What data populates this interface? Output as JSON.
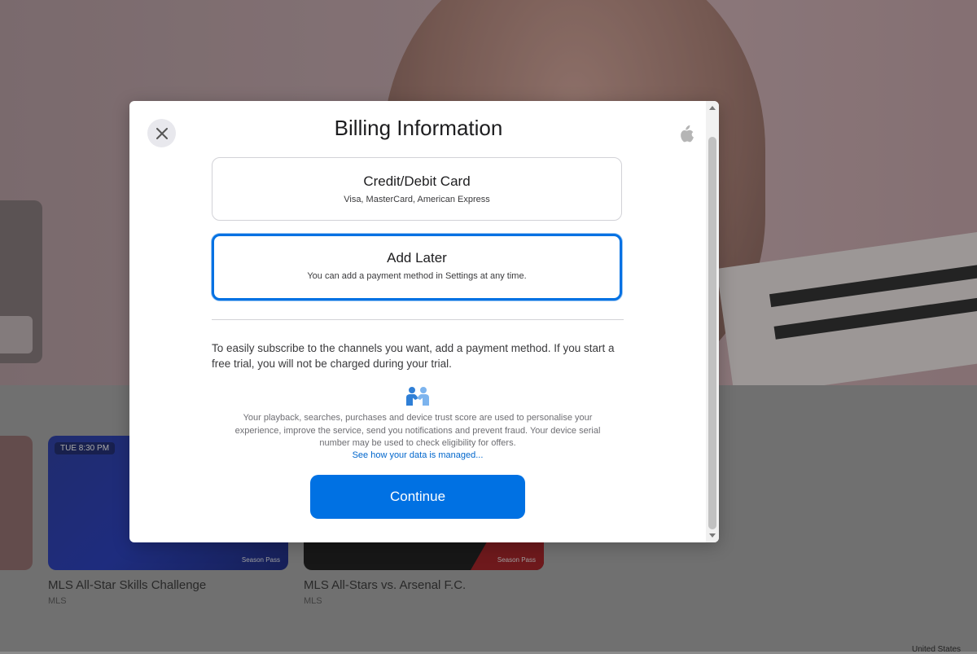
{
  "background": {
    "tiles": [
      {
        "badge": "TUE 8:30 PM",
        "logo": "Season Pass",
        "title": "MLS All-Star Skills Challenge",
        "subtitle": "MLS"
      },
      {
        "logo": "Season Pass",
        "title": "MLS All-Stars vs. Arsenal F.C.",
        "subtitle": "MLS"
      }
    ],
    "region": "United States"
  },
  "modal": {
    "title": "Billing Information",
    "close_icon": "close-icon",
    "brand_icon": "apple-logo-icon",
    "options": [
      {
        "title": "Credit/Debit Card",
        "subtitle": "Visa, MasterCard, American Express",
        "selected": false
      },
      {
        "title": "Add Later",
        "subtitle": "You can add a payment method in Settings at any time.",
        "selected": true
      }
    ],
    "description": "To easily subscribe to the channels you want, add a payment method. If you start a free trial, you will not be charged during your trial.",
    "privacy_icon": "data-privacy-handshake-icon",
    "privacy_text": "Your playback, searches, purchases and device trust score are used to personalise your experience, improve the service, send you notifications and prevent fraud. Your device serial number may be used to check eligibility for offers.",
    "privacy_link": "See how your data is managed...",
    "continue_label": "Continue",
    "accent_color": "#0071e3"
  }
}
